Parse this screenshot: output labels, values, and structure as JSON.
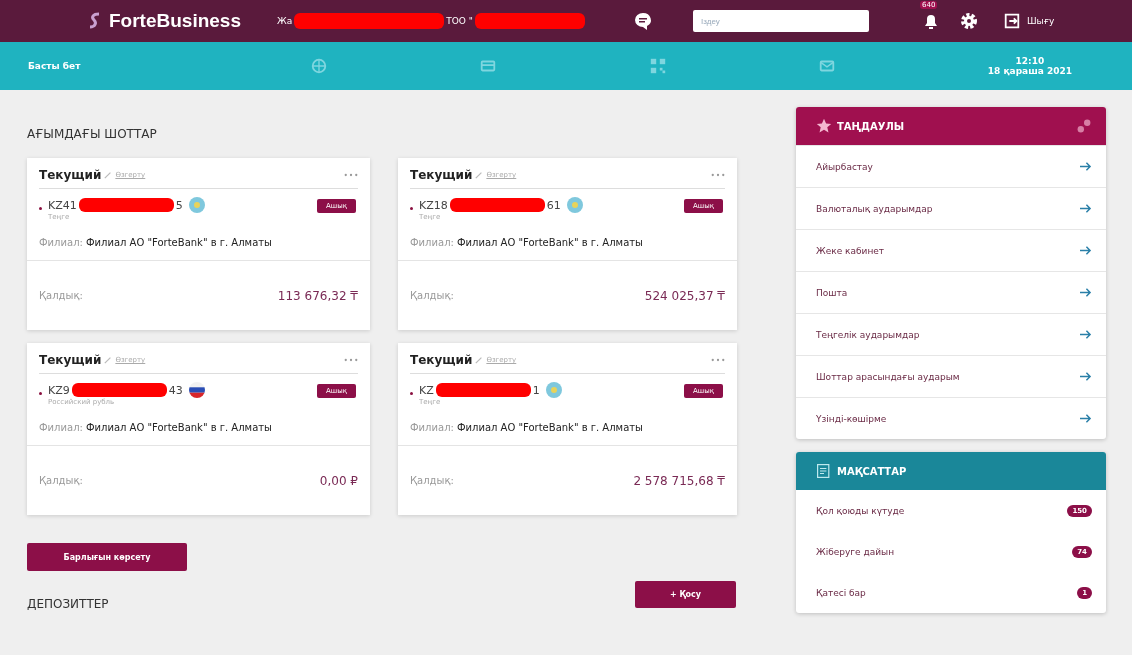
{
  "header": {
    "logo": "ForteBusiness",
    "user_prefix": "Жа",
    "company_prefix": "ТОО \"",
    "search": {
      "placeholder": "Іздеу"
    },
    "notifications": "640",
    "logout": "Шығу"
  },
  "nav": {
    "home": "Басты бет",
    "time": "12:10",
    "date": "18 қараша 2021"
  },
  "accounts_title": "АҒЫМДАҒЫ ШОТТАР",
  "accounts": [
    {
      "type": "Текущий",
      "edit": "Өзгерту",
      "prefix": "KZ41",
      "suffix": "5",
      "kind": "kzt",
      "currency": "Теңге",
      "status": "Ашық",
      "branch_label": "Филиал:",
      "branch": "Филиал АО \"ForteBank\" в г. Алматы",
      "balance_label": "Қалдық:",
      "balance": "113 676,32 ₸"
    },
    {
      "type": "Текущий",
      "edit": "Өзгерту",
      "prefix": "KZ18",
      "suffix": "61",
      "kind": "kzt",
      "currency": "Теңге",
      "status": "Ашық",
      "branch_label": "Филиал:",
      "branch": "Филиал АО \"ForteBank\" в г. Алматы",
      "balance_label": "Қалдық:",
      "balance": "524 025,37 ₸"
    },
    {
      "type": "Текущий",
      "edit": "Өзгерту",
      "prefix": "KZ9",
      "suffix": "43",
      "kind": "rub",
      "currency": "Российский рубль",
      "status": "Ашық",
      "branch_label": "Филиал:",
      "branch": "Филиал АО \"ForteBank\" в г. Алматы",
      "balance_label": "Қалдық:",
      "balance": "0,00 ₽"
    },
    {
      "type": "Текущий",
      "edit": "Өзгерту",
      "prefix": "KZ",
      "suffix": "1",
      "kind": "kzt",
      "currency": "Теңге",
      "status": "Ашық",
      "branch_label": "Филиал:",
      "branch": "Филиал АО \"ForteBank\" в г. Алматы",
      "balance_label": "Қалдық:",
      "balance": "2 578 715,68 ₸"
    }
  ],
  "show_all": "Барлығын көрсету",
  "deposits_title": "ДЕПОЗИТТЕР",
  "add_button": "+ Қосу",
  "favorites": {
    "title": "ТАҢДАУЛЫ",
    "items": [
      "Айырбастау",
      "Валюталық аударымдар",
      "Жеке кабинет",
      "Пошта",
      "Теңгелік аударымдар",
      "Шоттар арасындағы аударым",
      "Үзінді-көшірме"
    ]
  },
  "goals": {
    "title": "МАҚСАТТАР",
    "items": [
      {
        "label": "Қол қоюды күтуде",
        "count": "150"
      },
      {
        "label": "Жіберуге дайын",
        "count": "74"
      },
      {
        "label": "Қатесі бар",
        "count": "1"
      }
    ]
  }
}
